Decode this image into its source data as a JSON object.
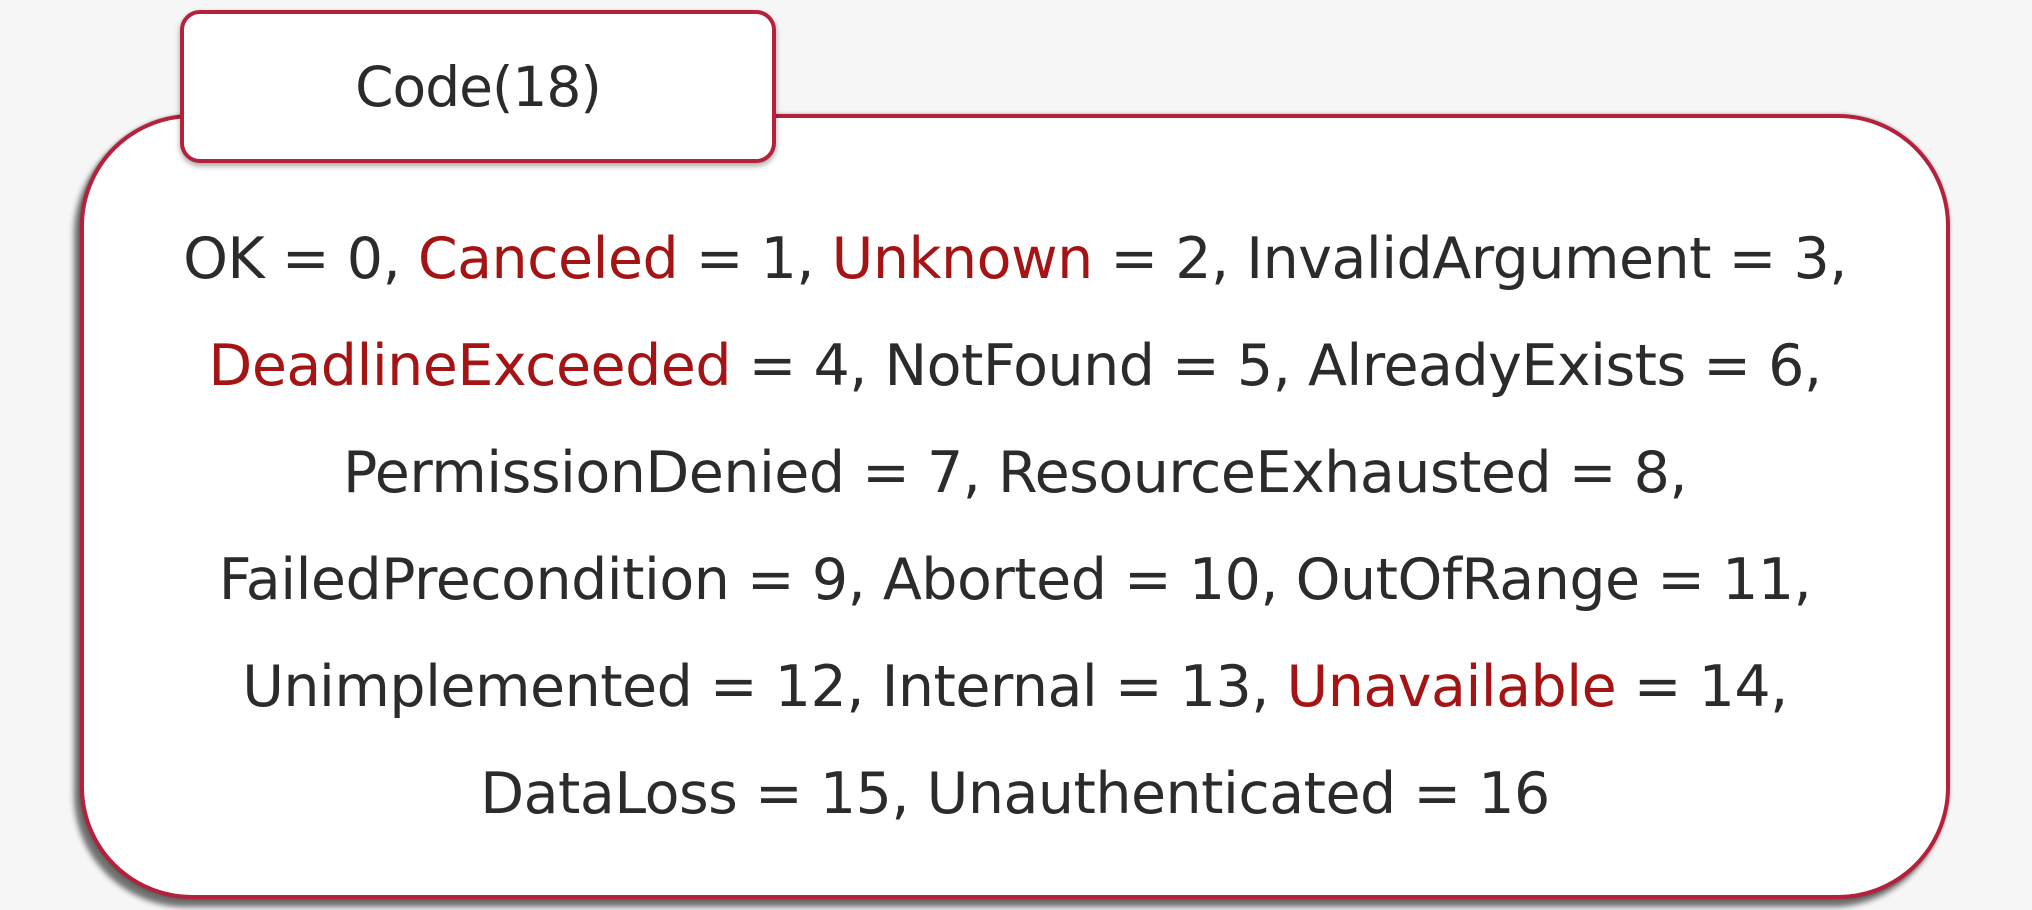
{
  "tab_label": "Code(18)",
  "colors": {
    "border": "#b5213a",
    "highlight": "#a51414",
    "text": "#2b2b2b"
  },
  "lines": [
    [
      {
        "text": "OK = 0, ",
        "highlight": false
      },
      {
        "text": "Canceled",
        "highlight": true
      },
      {
        "text": " = 1, ",
        "highlight": false
      },
      {
        "text": "Unknown",
        "highlight": true
      },
      {
        "text": " = 2, InvalidArgument = 3,",
        "highlight": false
      }
    ],
    [
      {
        "text": "DeadlineExceeded",
        "highlight": true
      },
      {
        "text": " = 4, NotFound = 5, AlreadyExists = 6,",
        "highlight": false
      }
    ],
    [
      {
        "text": "PermissionDenied = 7, ResourceExhausted = 8,",
        "highlight": false
      }
    ],
    [
      {
        "text": "FailedPrecondition = 9, Aborted = 10, OutOfRange = 11,",
        "highlight": false
      }
    ],
    [
      {
        "text": "Unimplemented = 12, Internal = 13, ",
        "highlight": false
      },
      {
        "text": "Unavailable",
        "highlight": true
      },
      {
        "text": " = 14,",
        "highlight": false
      }
    ],
    [
      {
        "text": "DataLoss = 15, Unauthenticated = 16",
        "highlight": false
      }
    ]
  ]
}
